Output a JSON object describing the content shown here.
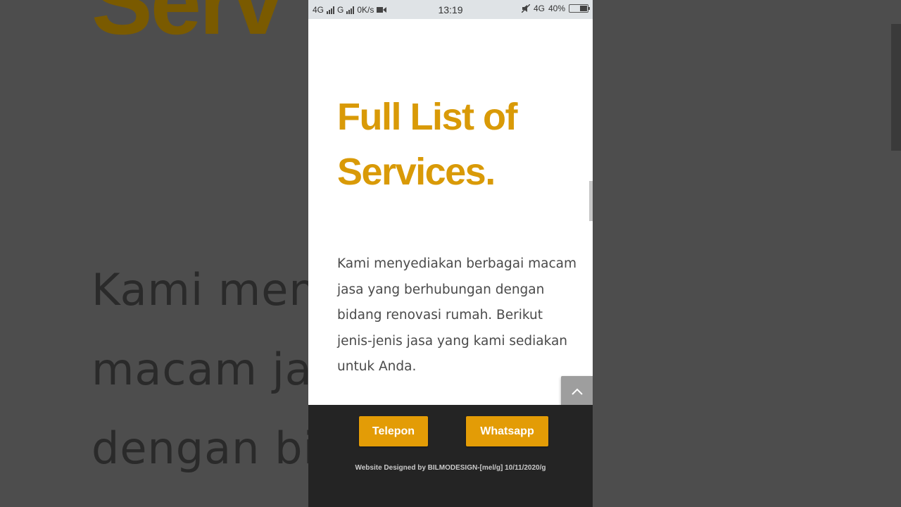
{
  "background": {
    "heading_fragment": "Serv",
    "lines": [
      "Kami meny                    bagai",
      "macam jas                    ubungan",
      "dengan bid                   i rumah."
    ]
  },
  "status_bar": {
    "network_1": "4G",
    "network_2": "G",
    "speed": "0K/s",
    "time": "13:19",
    "network_right": "4G",
    "battery_percent": "40%",
    "battery_level": 0.4
  },
  "page": {
    "title": "Full List of Services.",
    "description": "Kami menyediakan berbagai macam jasa yang berhubungan dengan bidang renovasi rumah. Berikut jenis-jenis jasa yang kami sediakan untuk Anda."
  },
  "footer": {
    "telepon_label": "Telepon",
    "whatsapp_label": "Whatsapp",
    "credit": "Website Designed by BILMODESIGN-[mel/g] 10/11/2020/g"
  },
  "colors": {
    "accent": "#d99a07",
    "button": "#e39c06",
    "footer_bg": "#242424"
  }
}
